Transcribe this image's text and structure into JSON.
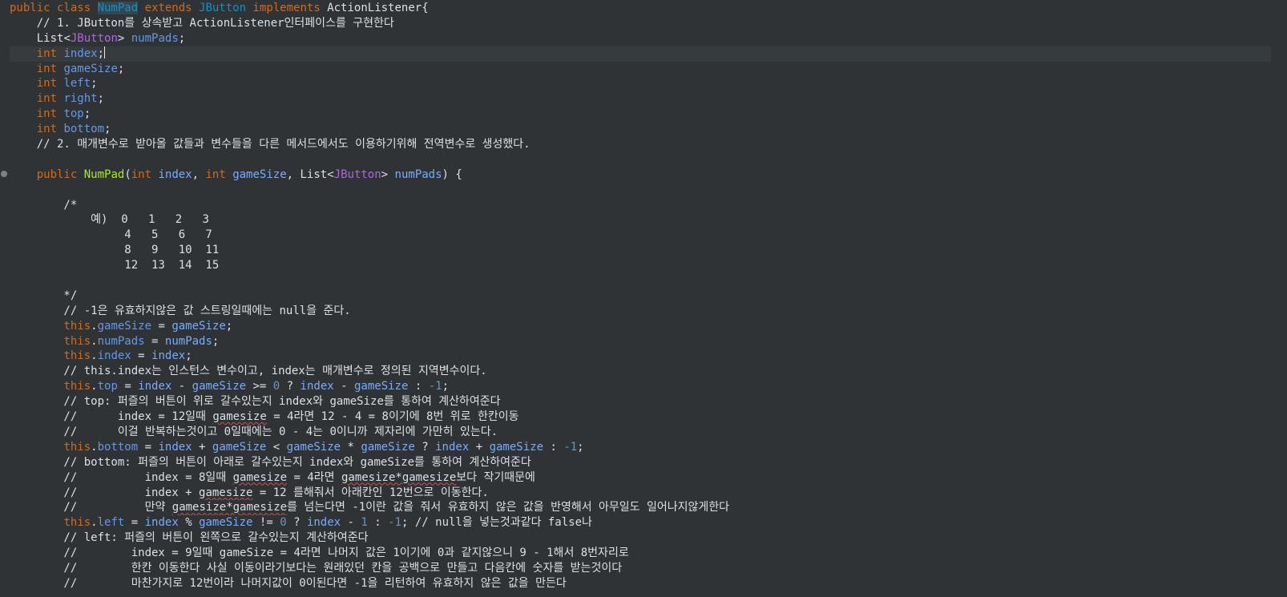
{
  "code": {
    "class_decl": {
      "kw1": "public class ",
      "name": "NumPad",
      "kw2": " extends ",
      "parent": "JButton",
      "kw3": " implements ",
      "iface": "ActionListener",
      "brace": "{"
    },
    "comment_1": "    // 1. JButton를 상속받고 ActionListener인터페이스를 구현한다",
    "field_list": {
      "indent": "    ",
      "type": "List",
      "open": "<",
      "generic": "JButton",
      "close": "> ",
      "name": "numPads",
      "semi": ";"
    },
    "fields": [
      {
        "kw": "int",
        "name": "index"
      },
      {
        "kw": "int",
        "name": "gameSize"
      },
      {
        "kw": "int",
        "name": "left"
      },
      {
        "kw": "int",
        "name": "right"
      },
      {
        "kw": "int",
        "name": "top"
      },
      {
        "kw": "int",
        "name": "bottom"
      }
    ],
    "comment_2": "    // 2. 매개변수로 받아올 값들과 변수들을 다른 메서드에서도 이용하기위해 전역변수로 생성했다.",
    "ctor": {
      "kw_public": "public ",
      "name": "NumPad",
      "open": "(",
      "kw_int1": "int ",
      "p1": "index",
      "sep1": ", ",
      "kw_int2": "int ",
      "p2": "gameSize",
      "sep2": ", List",
      "lt": "<",
      "generic": "JButton",
      "gt": "> ",
      "p3": "numPads",
      "close": ") {"
    },
    "block_comment": [
      "        /*",
      "            예)  0   1   2   3",
      "                 4   5   6   7",
      "                 8   9   10  11",
      "                 12  13  14  15",
      "",
      "        */"
    ],
    "comment_null": "        // -1은 유효하지않은 값 스트링일때에는 null을 준다.",
    "comment_this_index": "        // this.index는 인스턴스 변수이고, index는 매개변수로 정의된 지역변수이다.",
    "comment_top": [
      "        // top: 퍼즐의 버튼이 위로 갈수있는지 index와 gameSize를 통하여 계산하여준다",
      "        //      index = 12일때 ",
      "gamesize",
      " = 4라면 12 - 4 = 8이기에 8번 위로 한칸이동",
      "        //      이걸 반복하는것이고 0일때에는 0 - 4는 0이니까 제자리에 가만히 있는다."
    ],
    "comment_bottom": [
      "        // bottom: 퍼즐의 버튼이 아래로 갈수있는지 index와 gameSize를 통하여 계산하여준다",
      "        //          index = 8일때 ",
      "gamesize",
      " = 4라면 ",
      "gamesize*gamesize",
      "보다 작기때문에",
      "        //          index + ",
      "gamesize",
      " = 12 를해줘서 아래칸인 12번으로 이동한다.",
      "        //          만약 ",
      "gamesize*gamesize",
      "를 넘는다면 -1이란 값을 줘서 유효하지 않은 값을 반영해서 아무일도 일어나지않게한다"
    ],
    "comment_left": [
      "        // left: 퍼즐의 버튼이 왼쪽으로 갈수있는지 계산하여준다",
      "        //        index = 9일때 gameSize = 4라면 나머지 값은 1이기에 0과 같지않으니 9 - 1해서 8번자리로",
      "        //        한칸 이동한다 사실 이동이라기보다는 원래있던 칸을 공백으로 만들고 다음칸에 숫자를 받는것이다",
      "        //        마찬가지로 12번이라 나머지값이 0이된다면 -1을 리턴하여 유효하지 않은 값을 만든다"
    ],
    "stmt": {
      "this": "this",
      "dot": ".",
      "assign": " = ",
      "semi": ";",
      "gameSize": "gameSize",
      "numPads": "numPads",
      "index": "index",
      "top": "top",
      "bottom": "bottom",
      "left": "left",
      "minus": " - ",
      "plus": " + ",
      "ge": " >= ",
      "lt": " < ",
      "mul": " * ",
      "mod": " % ",
      "ne": " != ",
      "q": " ? ",
      "colon": " : ",
      "zero": "0",
      "one": "1",
      "neg1": "-1",
      "left_tail": "; // null을 넣는것과같다 false나"
    }
  }
}
